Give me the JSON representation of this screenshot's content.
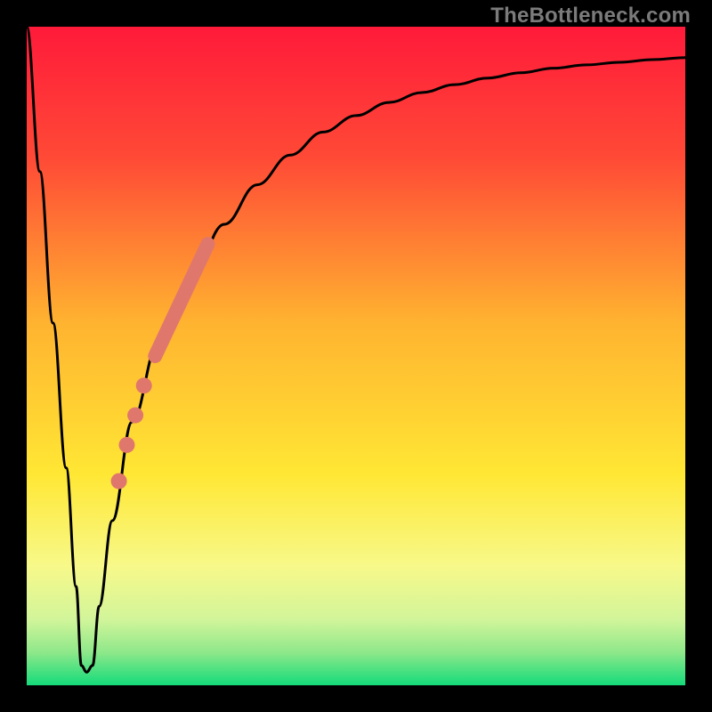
{
  "watermark": "TheBottleneck.com",
  "chart_data": {
    "type": "line",
    "title": "",
    "xlabel": "",
    "ylabel": "",
    "xlim": [
      0,
      100
    ],
    "ylim": [
      0,
      100
    ],
    "gradient_stops": [
      {
        "offset": 0.0,
        "color": "#ff1a3a"
      },
      {
        "offset": 0.2,
        "color": "#ff4a36"
      },
      {
        "offset": 0.45,
        "color": "#ffb330"
      },
      {
        "offset": 0.68,
        "color": "#ffe734"
      },
      {
        "offset": 0.82,
        "color": "#f7f98a"
      },
      {
        "offset": 0.9,
        "color": "#d2f59a"
      },
      {
        "offset": 0.95,
        "color": "#8ee88a"
      },
      {
        "offset": 1.0,
        "color": "#14db7a"
      }
    ],
    "series": [
      {
        "name": "bottleneck-curve",
        "x": [
          0,
          2,
          4,
          6,
          7.5,
          8.3,
          9.1,
          10,
          11,
          13,
          16,
          20,
          25,
          30,
          35,
          40,
          45,
          50,
          55,
          60,
          65,
          70,
          75,
          80,
          85,
          90,
          95,
          100
        ],
        "y": [
          100,
          78,
          55,
          33,
          15,
          3,
          2,
          3,
          12,
          25,
          40,
          52,
          62,
          70,
          76,
          80.5,
          84,
          86.5,
          88.5,
          90,
          91.2,
          92.2,
          93,
          93.7,
          94.2,
          94.6,
          95,
          95.3
        ]
      }
    ],
    "highlight_band": {
      "name": "gpu-range-band",
      "color": "#e0776c",
      "width": 16,
      "x": [
        19.5,
        27.5
      ],
      "y": [
        50,
        67
      ]
    },
    "highlight_points": {
      "name": "gpu-points",
      "color": "#e0776c",
      "radius": 9,
      "points": [
        {
          "x": 15.2,
          "y": 36.5
        },
        {
          "x": 16.5,
          "y": 41.0
        },
        {
          "x": 17.8,
          "y": 45.5
        },
        {
          "x": 14.0,
          "y": 31.0
        }
      ]
    }
  }
}
